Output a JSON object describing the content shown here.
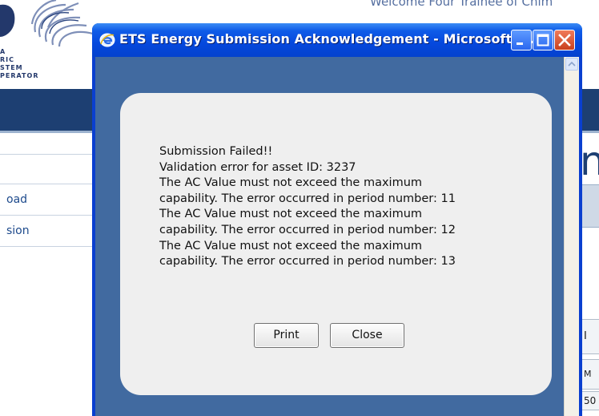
{
  "background_page": {
    "logo_lines": [
      "A",
      "RIC",
      "STEM",
      "PERATOR"
    ],
    "welcome_text": "Welcome Four Trainee of Chim",
    "side_menu": [
      "oad",
      "sion"
    ],
    "right_glyph": "n",
    "right_cells": [
      "I",
      "M",
      "50"
    ]
  },
  "window": {
    "title": "ETS Energy Submission Acknowledgement - Microsoft In...",
    "colors": {
      "titlebar": "#0548dd",
      "client": "#416aa0",
      "card": "#efefef"
    }
  },
  "message": {
    "lines": [
      "Submission Failed!!",
      "Validation error for asset ID: 3237",
      "The AC Value must not exceed the maximum",
      "capability. The error occurred in period number: 11",
      "The AC Value must not exceed the maximum",
      "capability. The error occurred in period number: 12",
      "The AC Value must not exceed the maximum",
      "capability. The error occurred in period number: 13"
    ]
  },
  "buttons": {
    "print": "Print",
    "close": "Close"
  }
}
